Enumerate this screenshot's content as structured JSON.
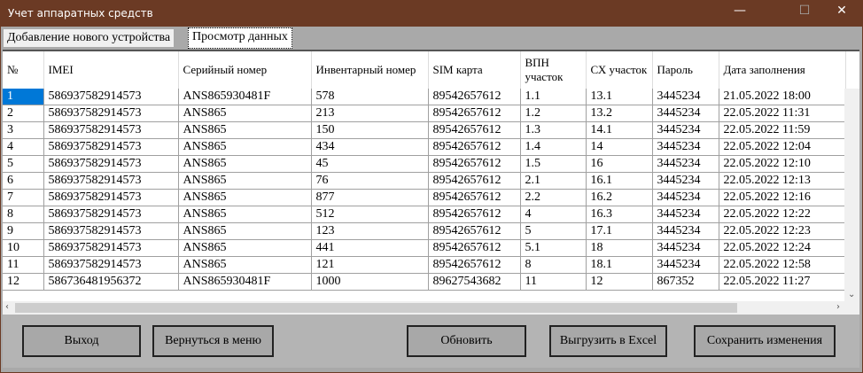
{
  "window": {
    "title": "Учет аппаратных средств",
    "minimize": "—",
    "maximize": "☐",
    "close": "✕"
  },
  "tabs": [
    {
      "label": "Добавление нового устройства"
    },
    {
      "label": "Просмотр данных"
    }
  ],
  "grid": {
    "columns": [
      "№",
      "IMEI",
      "Серийный номер",
      "Инвентарный номер",
      "SIM карта",
      "ВПН участок",
      "СХ участок",
      "Пароль",
      "Дата заполнения"
    ],
    "rows": [
      [
        "1",
        "586937582914573",
        "ANS865930481F",
        "578",
        "89542657612",
        "1.1",
        "13.1",
        "3445234",
        "21.05.2022 18:00"
      ],
      [
        "2",
        "586937582914573",
        "ANS865",
        "213",
        "89542657612",
        "1.2",
        "13.2",
        "3445234",
        "22.05.2022 11:31"
      ],
      [
        "3",
        "586937582914573",
        "ANS865",
        "150",
        "89542657612",
        "1.3",
        "14.1",
        "3445234",
        "22.05.2022 11:59"
      ],
      [
        "4",
        "586937582914573",
        "ANS865",
        "434",
        "89542657612",
        "1.4",
        "14",
        "3445234",
        "22.05.2022 12:04"
      ],
      [
        "5",
        "586937582914573",
        "ANS865",
        "45",
        "89542657612",
        "1.5",
        "16",
        "3445234",
        "22.05.2022 12:10"
      ],
      [
        "6",
        "586937582914573",
        "ANS865",
        "76",
        "89542657612",
        "2.1",
        "16.1",
        "3445234",
        "22.05.2022 12:13"
      ],
      [
        "7",
        "586937582914573",
        "ANS865",
        "877",
        "89542657612",
        "2.2",
        "16.2",
        "3445234",
        "22.05.2022 12:16"
      ],
      [
        "8",
        "586937582914573",
        "ANS865",
        "512",
        "89542657612",
        "4",
        "16.3",
        "3445234",
        "22.05.2022 12:22"
      ],
      [
        "9",
        "586937582914573",
        "ANS865",
        "123",
        "89542657612",
        "5",
        "17.1",
        "3445234",
        "22.05.2022 12:23"
      ],
      [
        "10",
        "586937582914573",
        "ANS865",
        "441",
        "89542657612",
        "5.1",
        "18",
        "3445234",
        "22.05.2022 12:24"
      ],
      [
        "11",
        "586937582914573",
        "ANS865",
        "121",
        "89542657612",
        "8",
        "18.1",
        "3445234",
        "22.05.2022 12:58"
      ],
      [
        "12",
        "586736481956372",
        "ANS865930481F",
        "1000",
        "89627543682",
        "11",
        "12",
        "867352",
        "22.05.2022 11:27"
      ]
    ],
    "selected_row": 1
  },
  "buttons": {
    "exit": "Выход",
    "back": "Вернуться в меню",
    "refresh": "Обновить",
    "export": "Выгрузить в Excel",
    "save": "Сохранить изменения"
  },
  "colors": {
    "titlebar": "#6b3a24",
    "selection": "#0078d7",
    "panel": "#b4b4b4"
  }
}
